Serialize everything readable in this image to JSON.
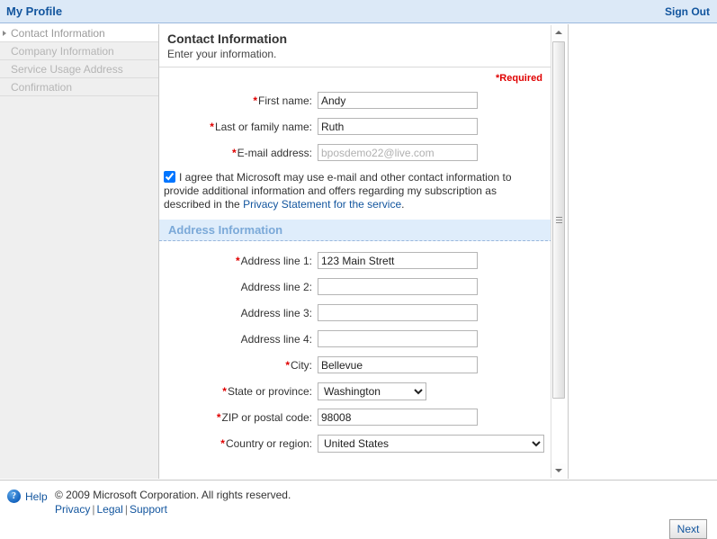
{
  "header": {
    "app_title": "My Profile",
    "sign_out_label": "Sign Out"
  },
  "sidebar": {
    "items": [
      {
        "label": "Contact Information",
        "active": true
      },
      {
        "label": "Company Information",
        "active": false
      },
      {
        "label": "Service Usage Address",
        "active": false
      },
      {
        "label": "Confirmation",
        "active": false
      }
    ]
  },
  "main": {
    "page_title": "Contact Information",
    "page_subtitle": "Enter your information.",
    "required_note": "*Required",
    "fields": {
      "first_name": {
        "label": "First name:",
        "required": true,
        "value": "Andy",
        "placeholder": ""
      },
      "last_name": {
        "label": "Last or family name:",
        "required": true,
        "value": "Ruth",
        "placeholder": ""
      },
      "email": {
        "label": "E-mail address:",
        "required": true,
        "value": "bposdemo22@live.com",
        "readonly": true
      },
      "address1": {
        "label": "Address line 1:",
        "required": true,
        "value": "123 Main Strett"
      },
      "address2": {
        "label": "Address line 2:",
        "required": false,
        "value": ""
      },
      "address3": {
        "label": "Address line 3:",
        "required": false,
        "value": ""
      },
      "address4": {
        "label": "Address line 4:",
        "required": false,
        "value": ""
      },
      "city": {
        "label": "City:",
        "required": true,
        "value": "Bellevue"
      },
      "state": {
        "label": "State or province:",
        "required": true,
        "value": "Washington"
      },
      "zip": {
        "label": "ZIP or postal code:",
        "required": true,
        "value": "98008"
      },
      "country": {
        "label": "Country or region:",
        "required": true,
        "value": "United States"
      }
    },
    "consent": {
      "checked": true,
      "text_before_link": "I agree that Microsoft may use e-mail and other contact information to provide additional information and offers regarding my subscription as described in the ",
      "link_text": "Privacy Statement for the service",
      "text_after_link": "."
    },
    "section_address": {
      "title": "Address Information"
    }
  },
  "scrollbar": {
    "up_arrow": "scroll-up",
    "down_arrow": "scroll-down",
    "thumb_position_percent": 0
  },
  "footer": {
    "help_label": "Help",
    "help_icon_glyph": "?",
    "copyright": "© 2009 Microsoft Corporation. All rights reserved.",
    "links": {
      "privacy": "Privacy",
      "legal": "Legal",
      "support": "Support",
      "separator": "|"
    },
    "next_label": "Next"
  },
  "colors": {
    "header_bg": "#dce9f7",
    "brand_blue": "#12559e",
    "required_red": "#e00000",
    "section_band_bg": "#dfedfb",
    "section_band_text": "#7ba9d8",
    "sidebar_bg": "#efefef"
  }
}
